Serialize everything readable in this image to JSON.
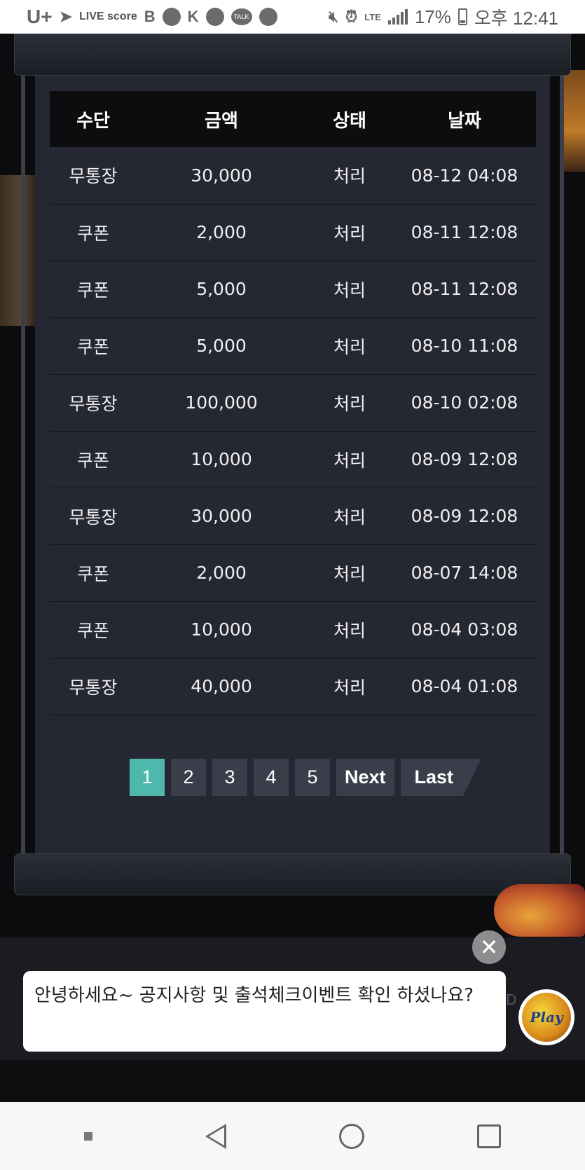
{
  "status_bar": {
    "carrier": "U+",
    "live_score": "LIVE score",
    "battery_percent": "17%",
    "time": "오후 12:41",
    "network": "LTE"
  },
  "table": {
    "headers": [
      "수단",
      "금액",
      "상태",
      "날짜"
    ],
    "rows": [
      {
        "method": "무통장",
        "amount": "30,000",
        "status": "처리",
        "date": "08-12 04:08"
      },
      {
        "method": "쿠폰",
        "amount": "2,000",
        "status": "처리",
        "date": "08-11 12:08"
      },
      {
        "method": "쿠폰",
        "amount": "5,000",
        "status": "처리",
        "date": "08-11 12:08"
      },
      {
        "method": "쿠폰",
        "amount": "5,000",
        "status": "처리",
        "date": "08-10 11:08"
      },
      {
        "method": "무통장",
        "amount": "100,000",
        "status": "처리",
        "date": "08-10 02:08"
      },
      {
        "method": "쿠폰",
        "amount": "10,000",
        "status": "처리",
        "date": "08-09 12:08"
      },
      {
        "method": "무통장",
        "amount": "30,000",
        "status": "처리",
        "date": "08-09 12:08"
      },
      {
        "method": "쿠폰",
        "amount": "2,000",
        "status": "처리",
        "date": "08-07 14:08"
      },
      {
        "method": "쿠폰",
        "amount": "10,000",
        "status": "처리",
        "date": "08-04 03:08"
      },
      {
        "method": "무통장",
        "amount": "40,000",
        "status": "처리",
        "date": "08-04 01:08"
      }
    ]
  },
  "pagination": {
    "pages": [
      "1",
      "2",
      "3",
      "4",
      "5"
    ],
    "active_page": "1",
    "next_label": "Next",
    "last_label": "Last"
  },
  "chat": {
    "message": "안녕하세요~ 공지사항 및 출석체크이벤트 확인 하셨나요?",
    "close_symbol": "✕",
    "avatar_text": "Play"
  },
  "colors": {
    "active_page": "#4fb8ad",
    "panel_bg": "#252732",
    "header_bg": "#0d0d0f"
  }
}
